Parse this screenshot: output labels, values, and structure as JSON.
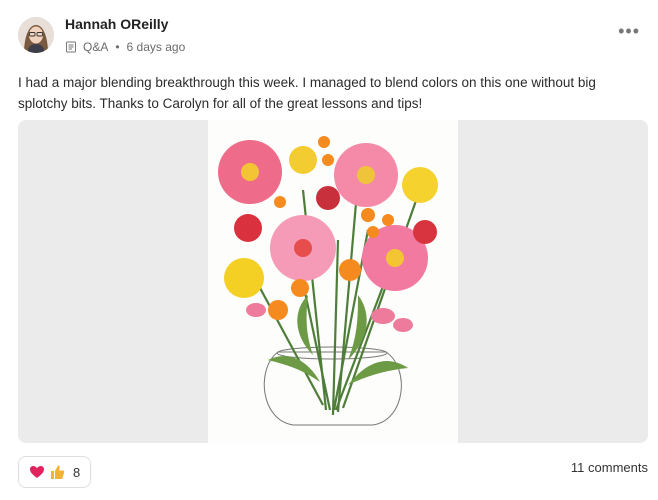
{
  "post": {
    "author_name": "Hannah OReilly",
    "category": "Q&A",
    "time_ago": "6 days ago",
    "separator": "•",
    "more_label": "•••",
    "body": "I had a major blending breakthrough this week. I managed to blend colors on this one without big splotchy bits. Thanks to Carolyn for all of the great lessons and tips!",
    "reaction_count": "8",
    "comments_label": "11 comments"
  },
  "icons": {
    "category": "document-icon",
    "heart": "heart-icon",
    "thumbs": "thumbs-up-icon",
    "more": "more-horizontal-icon"
  },
  "colors": {
    "media_bg": "#ebebeb",
    "heart": "#e0245e",
    "thumbs": "#f2b233"
  }
}
